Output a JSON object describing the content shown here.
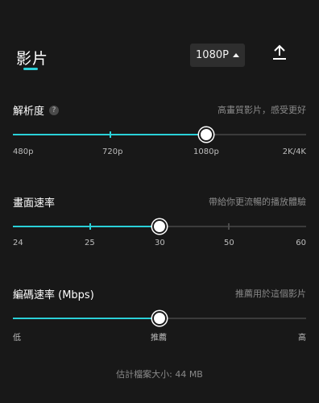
{
  "tab": {
    "label": "影片"
  },
  "resolution_button": {
    "label": "1080P"
  },
  "resolution": {
    "title": "解析度",
    "help": "?",
    "hint": "高畫質影片，感受更好",
    "labels": [
      "480p",
      "720p",
      "1080p",
      "2K/4K"
    ],
    "value_fraction": 0.66
  },
  "framerate": {
    "title": "畫面速率",
    "hint": "帶給你更流暢的播放體驗",
    "labels": [
      "24",
      "25",
      "30",
      "50",
      "60"
    ],
    "value_fraction": 0.5
  },
  "bitrate": {
    "title": "編碼速率 (Mbps)",
    "hint": "推薦用於這個影片",
    "labels": [
      "低",
      "推薦",
      "高"
    ],
    "value_fraction": 0.5
  },
  "footer": {
    "text": "估計檔案大小: 44 MB"
  },
  "colors": {
    "accent": "#2ad0d8",
    "background": "#181818",
    "track": "#3b3b3b"
  },
  "icons": {
    "export": "upload-icon",
    "help": "question-circle-icon",
    "caret": "caret-up-icon"
  }
}
